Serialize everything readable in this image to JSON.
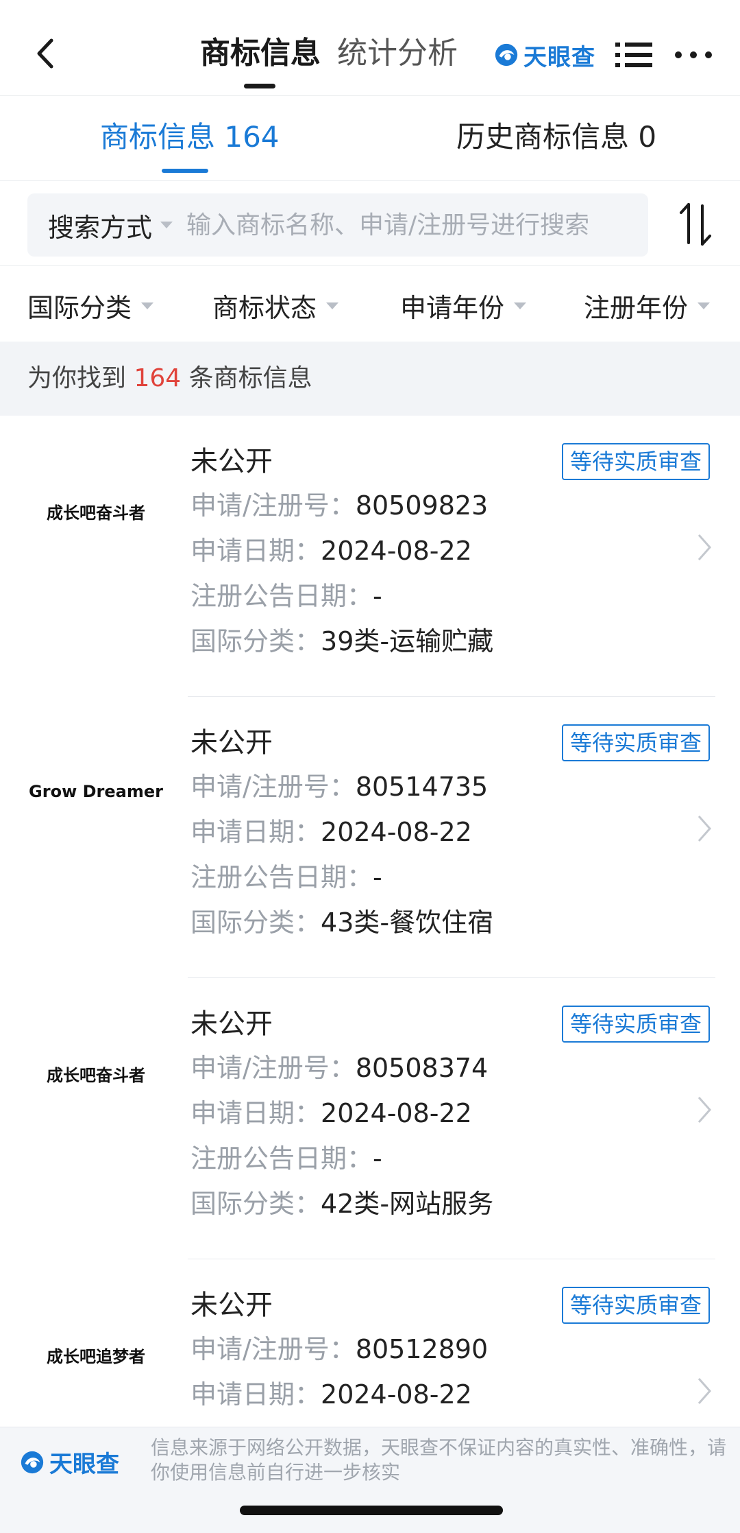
{
  "nav": {
    "tabs": [
      "商标信息",
      "统计分析"
    ],
    "brand": "天眼查"
  },
  "subtabs": {
    "active": "商标信息 164",
    "inactive": "历史商标信息 0"
  },
  "search": {
    "mode_label": "搜索方式",
    "placeholder": "输入商标名称、申请/注册号进行搜索"
  },
  "filters": [
    "国际分类",
    "商标状态",
    "申请年份",
    "注册年份"
  ],
  "result_banner": {
    "prefix": "为你找到 ",
    "count": "164",
    "suffix": " 条商标信息"
  },
  "labels": {
    "reg_no": "申请/注册号：",
    "apply_date": "申请日期：",
    "announce_date": "注册公告日期：",
    "intl_class": "国际分类："
  },
  "items": [
    {
      "logo_text": "成长吧奋斗者",
      "title": "未公开",
      "badge": "等待实质审查",
      "reg_no": "80509823",
      "apply_date": "2024-08-22",
      "announce_date": "-",
      "intl_class": "39类-运输贮藏"
    },
    {
      "logo_text": "Grow Dreamer",
      "title": "未公开",
      "badge": "等待实质审查",
      "reg_no": "80514735",
      "apply_date": "2024-08-22",
      "announce_date": "-",
      "intl_class": "43类-餐饮住宿"
    },
    {
      "logo_text": "成长吧奋斗者",
      "title": "未公开",
      "badge": "等待实质审查",
      "reg_no": "80508374",
      "apply_date": "2024-08-22",
      "announce_date": "-",
      "intl_class": "42类-网站服务"
    },
    {
      "logo_text": "成长吧追梦者",
      "title": "未公开",
      "badge": "等待实质审查",
      "reg_no": "80512890",
      "apply_date": "2024-08-22"
    }
  ],
  "footer": {
    "brand": "天眼查",
    "disclaimer": "信息来源于网络公开数据，天眼查不保证内容的真实性、准确性，请你使用信息前自行进一步核实"
  },
  "colors": {
    "accent": "#1a7ad6",
    "highlight": "#e0433b"
  }
}
